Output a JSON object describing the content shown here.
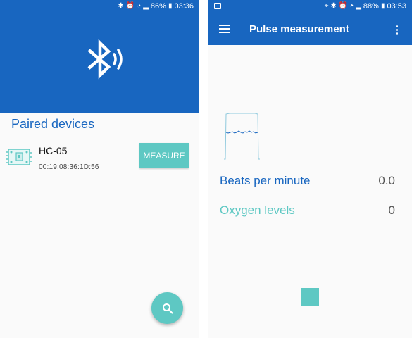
{
  "left": {
    "status": {
      "battery": "86%",
      "time": "03:36"
    },
    "section_title": "Paired devices",
    "devices": [
      {
        "name": "HC-05",
        "address": "00:19:08:36:1D:56",
        "action_label": "MEASURE"
      }
    ],
    "fab_icon": "search-icon",
    "header_icon": "bluetooth-searching-icon"
  },
  "right": {
    "status": {
      "battery": "88%",
      "time": "03:53"
    },
    "title": "Pulse measurement",
    "metrics": {
      "bpm_label": "Beats per minute",
      "bpm_value": "0.0",
      "oxygen_label": "Oxygen levels",
      "oxygen_value": "0"
    }
  },
  "colors": {
    "primary": "#1866c0",
    "accent": "#5ec8c3"
  }
}
